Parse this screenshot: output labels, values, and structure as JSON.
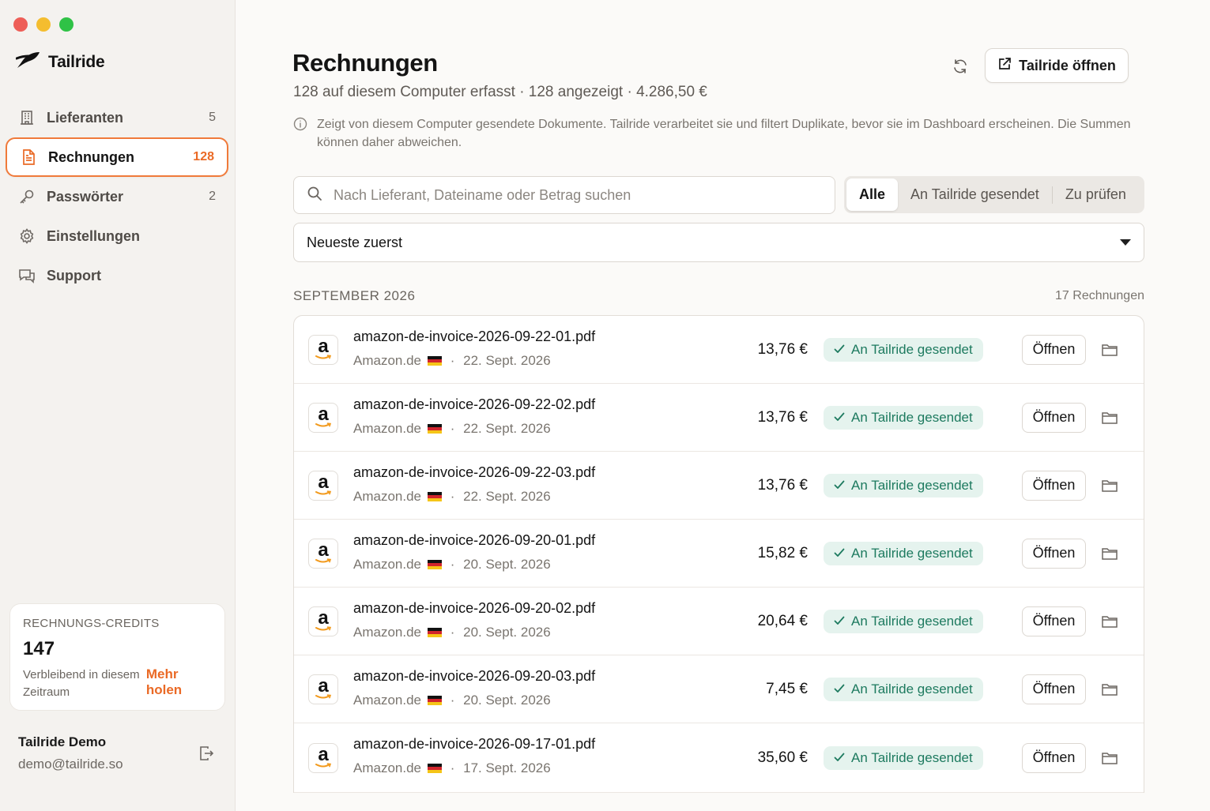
{
  "app": {
    "name": "Tailride"
  },
  "sidebar": {
    "items": [
      {
        "label": "Lieferanten",
        "count": "5",
        "icon": "building-icon"
      },
      {
        "label": "Rechnungen",
        "count": "128",
        "icon": "document-icon"
      },
      {
        "label": "Passwörter",
        "count": "2",
        "icon": "key-icon"
      },
      {
        "label": "Einstellungen",
        "count": "",
        "icon": "gear-icon"
      },
      {
        "label": "Support",
        "count": "",
        "icon": "chat-icon"
      }
    ],
    "credits": {
      "title": "RECHNUNGS-CREDITS",
      "value": "147",
      "subtitle": "Verbleibend in diesem Zeitraum",
      "link": "Mehr holen"
    },
    "user": {
      "name": "Tailride Demo",
      "email": "demo@tailride.so"
    }
  },
  "header": {
    "title": "Rechnungen",
    "subtitle": "128 auf diesem Computer erfasst · 128 angezeigt · 4.286,50 €",
    "open_button": "Tailride öffnen",
    "info": "Zeigt von diesem Computer gesendete Dokumente. Tailride verarbeitet sie und filtert Duplikate, bevor sie im Dashboard erscheinen. Die Summen können daher abweichen."
  },
  "search": {
    "placeholder": "Nach Lieferant, Dateiname oder Betrag suchen",
    "value": ""
  },
  "filters": {
    "all": "Alle",
    "sent": "An Tailride gesendet",
    "review": "Zu prüfen",
    "selected": "Alle"
  },
  "sort": {
    "value": "Neueste zuerst"
  },
  "section": {
    "title": "SEPTEMBER 2026",
    "count": "17 Rechnungen"
  },
  "invoices": [
    {
      "file": "amazon-de-invoice-2026-09-22-01.pdf",
      "vendor": "Amazon.de",
      "date": "22. Sept. 2026",
      "amount": "13,76 €",
      "status": "An Tailride gesendet",
      "action": "Öffnen"
    },
    {
      "file": "amazon-de-invoice-2026-09-22-02.pdf",
      "vendor": "Amazon.de",
      "date": "22. Sept. 2026",
      "amount": "13,76 €",
      "status": "An Tailride gesendet",
      "action": "Öffnen"
    },
    {
      "file": "amazon-de-invoice-2026-09-22-03.pdf",
      "vendor": "Amazon.de",
      "date": "22. Sept. 2026",
      "amount": "13,76 €",
      "status": "An Tailride gesendet",
      "action": "Öffnen"
    },
    {
      "file": "amazon-de-invoice-2026-09-20-01.pdf",
      "vendor": "Amazon.de",
      "date": "20. Sept. 2026",
      "amount": "15,82 €",
      "status": "An Tailride gesendet",
      "action": "Öffnen"
    },
    {
      "file": "amazon-de-invoice-2026-09-20-02.pdf",
      "vendor": "Amazon.de",
      "date": "20. Sept. 2026",
      "amount": "20,64 €",
      "status": "An Tailride gesendet",
      "action": "Öffnen"
    },
    {
      "file": "amazon-de-invoice-2026-09-20-03.pdf",
      "vendor": "Amazon.de",
      "date": "20. Sept. 2026",
      "amount": "7,45 €",
      "status": "An Tailride gesendet",
      "action": "Öffnen"
    },
    {
      "file": "amazon-de-invoice-2026-09-17-01.pdf",
      "vendor": "Amazon.de",
      "date": "17. Sept. 2026",
      "amount": "35,60 €",
      "status": "An Tailride gesendet",
      "action": "Öffnen"
    }
  ],
  "colors": {
    "accent": "#ea6a26",
    "success_bg": "#e5f3ee",
    "success_text": "#1d7a5f",
    "sidebar_bg": "#f4f2ef"
  }
}
